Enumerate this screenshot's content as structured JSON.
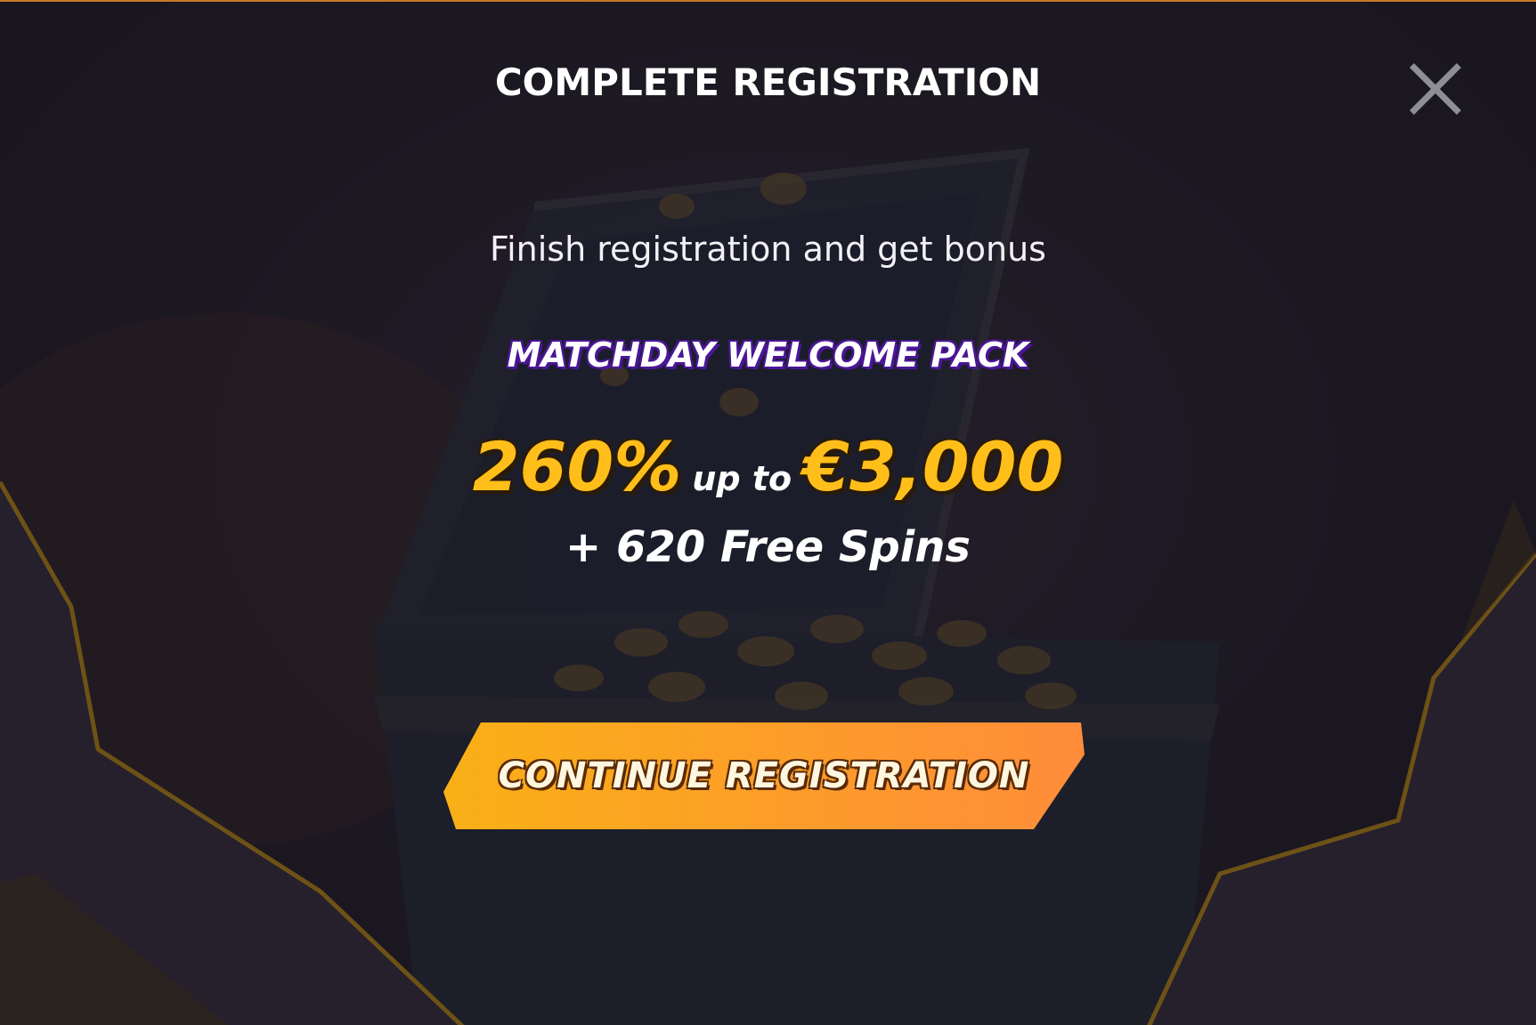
{
  "modal": {
    "title": "COMPLETE REGISTRATION",
    "subtitle": "Finish registration and get bonus",
    "pack_name": "MATCHDAY WELCOME PACK",
    "offer": {
      "percent": "260%",
      "connector": "up to",
      "amount": "€3,000",
      "extra": "+ 620 Free Spins"
    },
    "cta_label": "CONTINUE REGISTRATION",
    "close_icon": "close-icon"
  },
  "colors": {
    "background": "#1e1a24",
    "accent_gold": "#ffbe1a",
    "button_start": "#f9b016",
    "button_end": "#ff8c3a",
    "pack_outline": "#4a1696"
  }
}
